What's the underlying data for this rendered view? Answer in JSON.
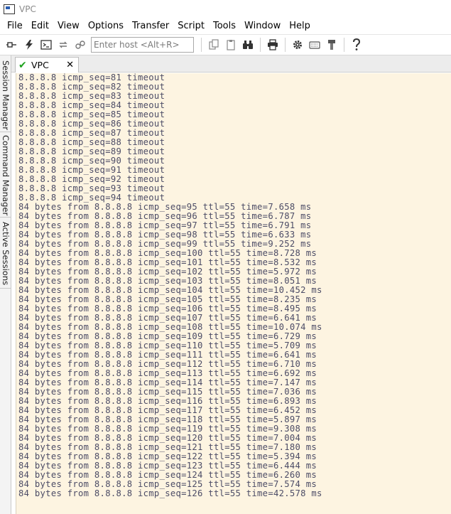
{
  "window": {
    "title": "VPC"
  },
  "menu": [
    "File",
    "Edit",
    "View",
    "Options",
    "Transfer",
    "Script",
    "Tools",
    "Window",
    "Help"
  ],
  "toolbar": {
    "host_placeholder": "Enter host <Alt+R>"
  },
  "sidebar": {
    "tabs": [
      "Session Manager",
      "Command Manager",
      "Active Sessions"
    ]
  },
  "session_tab": {
    "label": "VPC",
    "close": "✕"
  },
  "terminal_lines": [
    "8.8.8.8 icmp_seq=81 timeout",
    "8.8.8.8 icmp_seq=82 timeout",
    "8.8.8.8 icmp_seq=83 timeout",
    "8.8.8.8 icmp_seq=84 timeout",
    "8.8.8.8 icmp_seq=85 timeout",
    "8.8.8.8 icmp_seq=86 timeout",
    "8.8.8.8 icmp_seq=87 timeout",
    "8.8.8.8 icmp_seq=88 timeout",
    "8.8.8.8 icmp_seq=89 timeout",
    "8.8.8.8 icmp_seq=90 timeout",
    "8.8.8.8 icmp_seq=91 timeout",
    "8.8.8.8 icmp_seq=92 timeout",
    "8.8.8.8 icmp_seq=93 timeout",
    "8.8.8.8 icmp_seq=94 timeout",
    "84 bytes from 8.8.8.8 icmp_seq=95 ttl=55 time=7.658 ms",
    "84 bytes from 8.8.8.8 icmp_seq=96 ttl=55 time=6.787 ms",
    "84 bytes from 8.8.8.8 icmp_seq=97 ttl=55 time=6.791 ms",
    "84 bytes from 8.8.8.8 icmp_seq=98 ttl=55 time=6.633 ms",
    "84 bytes from 8.8.8.8 icmp_seq=99 ttl=55 time=9.252 ms",
    "84 bytes from 8.8.8.8 icmp_seq=100 ttl=55 time=8.728 ms",
    "84 bytes from 8.8.8.8 icmp_seq=101 ttl=55 time=8.532 ms",
    "84 bytes from 8.8.8.8 icmp_seq=102 ttl=55 time=5.972 ms",
    "84 bytes from 8.8.8.8 icmp_seq=103 ttl=55 time=8.051 ms",
    "84 bytes from 8.8.8.8 icmp_seq=104 ttl=55 time=10.452 ms",
    "84 bytes from 8.8.8.8 icmp_seq=105 ttl=55 time=8.235 ms",
    "84 bytes from 8.8.8.8 icmp_seq=106 ttl=55 time=8.495 ms",
    "84 bytes from 8.8.8.8 icmp_seq=107 ttl=55 time=6.641 ms",
    "84 bytes from 8.8.8.8 icmp_seq=108 ttl=55 time=10.074 ms",
    "84 bytes from 8.8.8.8 icmp_seq=109 ttl=55 time=6.729 ms",
    "84 bytes from 8.8.8.8 icmp_seq=110 ttl=55 time=5.709 ms",
    "84 bytes from 8.8.8.8 icmp_seq=111 ttl=55 time=6.641 ms",
    "84 bytes from 8.8.8.8 icmp_seq=112 ttl=55 time=6.710 ms",
    "84 bytes from 8.8.8.8 icmp_seq=113 ttl=55 time=6.692 ms",
    "84 bytes from 8.8.8.8 icmp_seq=114 ttl=55 time=7.147 ms",
    "84 bytes from 8.8.8.8 icmp_seq=115 ttl=55 time=7.036 ms",
    "84 bytes from 8.8.8.8 icmp_seq=116 ttl=55 time=6.893 ms",
    "84 bytes from 8.8.8.8 icmp_seq=117 ttl=55 time=6.452 ms",
    "84 bytes from 8.8.8.8 icmp_seq=118 ttl=55 time=5.897 ms",
    "84 bytes from 8.8.8.8 icmp_seq=119 ttl=55 time=9.308 ms",
    "84 bytes from 8.8.8.8 icmp_seq=120 ttl=55 time=7.004 ms",
    "84 bytes from 8.8.8.8 icmp_seq=121 ttl=55 time=7.180 ms",
    "84 bytes from 8.8.8.8 icmp_seq=122 ttl=55 time=5.394 ms",
    "84 bytes from 8.8.8.8 icmp_seq=123 ttl=55 time=6.444 ms",
    "84 bytes from 8.8.8.8 icmp_seq=124 ttl=55 time=6.260 ms",
    "84 bytes from 8.8.8.8 icmp_seq=125 ttl=55 time=7.574 ms",
    "84 bytes from 8.8.8.8 icmp_seq=126 ttl=55 time=42.578 ms"
  ],
  "colors": {
    "terminal_bg": "#fdf4e1",
    "terminal_text": "#4c4c66",
    "connected_check": "#1fa31f"
  }
}
